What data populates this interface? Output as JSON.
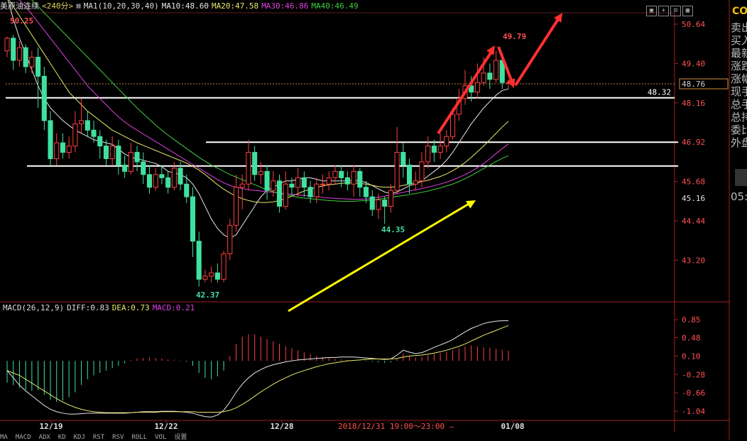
{
  "header": {
    "title": "美原油连续",
    "period": "<240分>",
    "ma_label": "MA1(10,20,30,40)",
    "ma10": "MA10:48.60",
    "ma20": "MA20:47.58",
    "ma30": "MA30:46.86",
    "ma40": "MA40:46.49"
  },
  "colors": {
    "ma10": "#e8e8e8",
    "ma20": "#e8e86a",
    "ma30": "#e040e0",
    "ma40": "#40d040",
    "up": "#ff4040",
    "down": "#40e0a0",
    "hline": "#ffffff",
    "arrow_red": "#ff3030",
    "arrow_yellow": "#ffff00"
  },
  "price_axis": {
    "ticks": [
      "50.64",
      "49.40",
      "48.16",
      "46.92",
      "45.68",
      "44.44",
      "43.20"
    ],
    "current": "48.76",
    "level_label": "48.32",
    "extra": "45.16"
  },
  "price_annotations": {
    "high": "50.25",
    "peak": "49.79",
    "low1": "42.37",
    "low2": "44.35"
  },
  "macd": {
    "label": "MACD(26,12,9)",
    "diff": "DIFF:0.83",
    "dea": "DEA:0.73",
    "macd": "MACD:0.21",
    "ticks": [
      "0.85",
      "0.48",
      "0.10",
      "-0.28",
      "-0.66",
      "-1.04"
    ]
  },
  "time_axis": {
    "labels": [
      "12/19",
      "12/22",
      "12/28",
      "01/08"
    ],
    "cursor": "2018/12/31 19:00～23:00 —"
  },
  "tabs": [
    "MA",
    "MACD",
    "ADX",
    "KD",
    "KDJ",
    "RST",
    "RSV",
    "ROLL",
    "VOL",
    "设置"
  ],
  "side": {
    "code": "CO",
    "lines": [
      "卖出",
      "买入",
      "最新",
      "涨跌",
      "涨幅",
      "现手",
      "总手",
      "总持",
      "委比",
      "外盘"
    ],
    "time": "05:5"
  },
  "chart_data": {
    "type": "candlestick",
    "ylim": [
      42.0,
      51.0
    ],
    "horizontal_levels": [
      48.32,
      46.92,
      46.17
    ],
    "candles": [
      [
        49.8,
        50.2,
        50.25,
        49.6
      ],
      [
        50.2,
        49.5,
        50.3,
        49.2
      ],
      [
        49.5,
        49.9,
        50.1,
        49.3
      ],
      [
        49.9,
        49.3,
        50.0,
        49.1
      ],
      [
        49.3,
        49.6,
        49.8,
        49.1
      ],
      [
        49.6,
        49.0,
        49.9,
        48.0
      ],
      [
        49.0,
        47.6,
        49.3,
        47.3
      ],
      [
        47.6,
        46.4,
        47.9,
        46.2
      ],
      [
        46.4,
        46.9,
        47.2,
        46.2
      ],
      [
        46.9,
        46.6,
        47.2,
        46.4
      ],
      [
        46.6,
        46.8,
        47.1,
        46.4
      ],
      [
        46.8,
        47.5,
        47.9,
        46.6
      ],
      [
        47.5,
        47.6,
        48.3,
        47.2
      ],
      [
        47.6,
        47.3,
        47.9,
        47.1
      ],
      [
        47.3,
        47.1,
        47.6,
        46.9
      ],
      [
        47.1,
        46.8,
        47.3,
        46.4
      ],
      [
        46.8,
        46.4,
        47.0,
        46.2
      ],
      [
        46.4,
        46.8,
        47.1,
        46.2
      ],
      [
        46.8,
        46.2,
        47.0,
        45.9
      ],
      [
        46.2,
        46.0,
        46.5,
        45.8
      ],
      [
        46.0,
        46.6,
        46.9,
        45.9
      ],
      [
        46.6,
        46.3,
        46.8,
        46.0
      ],
      [
        46.3,
        45.9,
        46.6,
        45.6
      ],
      [
        45.9,
        45.5,
        46.2,
        45.3
      ],
      [
        45.5,
        45.9,
        46.1,
        45.4
      ],
      [
        45.9,
        45.8,
        46.2,
        45.6
      ],
      [
        45.8,
        45.5,
        46.0,
        45.3
      ],
      [
        45.5,
        46.1,
        46.3,
        45.4
      ],
      [
        46.1,
        45.6,
        46.3,
        45.4
      ],
      [
        45.6,
        45.2,
        45.9,
        45.0
      ],
      [
        45.2,
        43.8,
        45.5,
        43.3
      ],
      [
        43.8,
        42.6,
        44.1,
        42.37
      ],
      [
        42.6,
        42.7,
        42.9,
        42.5
      ],
      [
        42.7,
        42.8,
        43.0,
        42.5
      ],
      [
        42.8,
        42.6,
        43.1,
        42.5
      ],
      [
        42.6,
        43.4,
        43.5,
        42.5
      ],
      [
        43.4,
        44.3,
        44.5,
        43.2
      ],
      [
        44.3,
        45.5,
        45.9,
        44.1
      ],
      [
        45.5,
        45.6,
        45.9,
        44.8
      ],
      [
        45.6,
        46.6,
        47.0,
        45.4
      ],
      [
        46.6,
        45.9,
        46.8,
        45.7
      ],
      [
        45.9,
        46.0,
        46.3,
        45.6
      ],
      [
        46.0,
        45.4,
        46.2,
        45.1
      ],
      [
        45.4,
        45.7,
        46.0,
        45.2
      ],
      [
        45.7,
        44.9,
        45.9,
        44.7
      ],
      [
        44.9,
        45.6,
        46.0,
        44.8
      ],
      [
        45.6,
        45.5,
        45.8,
        45.2
      ],
      [
        45.5,
        45.8,
        46.1,
        45.2
      ],
      [
        45.8,
        45.5,
        46.0,
        45.2
      ],
      [
        45.5,
        45.2,
        45.7,
        45.0
      ],
      [
        45.2,
        45.6,
        45.8,
        45.0
      ],
      [
        45.6,
        45.6,
        45.9,
        45.3
      ],
      [
        45.6,
        45.8,
        46.0,
        45.4
      ],
      [
        45.8,
        46.0,
        46.2,
        45.6
      ],
      [
        46.0,
        45.8,
        46.2,
        45.5
      ],
      [
        45.8,
        45.6,
        46.0,
        45.4
      ],
      [
        45.6,
        46.0,
        46.2,
        45.2
      ],
      [
        46.0,
        45.5,
        46.1,
        45.2
      ],
      [
        45.5,
        45.2,
        45.7,
        45.0
      ],
      [
        45.2,
        44.8,
        45.4,
        44.6
      ],
      [
        44.8,
        45.1,
        45.3,
        44.5
      ],
      [
        45.1,
        44.9,
        45.2,
        44.35
      ],
      [
        44.9,
        45.4,
        45.6,
        44.7
      ],
      [
        45.4,
        46.6,
        47.4,
        45.3
      ],
      [
        46.6,
        46.2,
        46.9,
        45.8
      ],
      [
        46.2,
        45.6,
        46.4,
        45.3
      ],
      [
        45.6,
        45.7,
        46.0,
        45.4
      ],
      [
        45.7,
        46.3,
        46.6,
        45.5
      ],
      [
        46.3,
        46.8,
        47.1,
        46.1
      ],
      [
        46.8,
        46.6,
        47.0,
        46.3
      ],
      [
        46.6,
        46.8,
        47.2,
        46.4
      ],
      [
        46.8,
        47.1,
        47.3,
        46.6
      ],
      [
        47.1,
        47.8,
        48.0,
        47.0
      ],
      [
        47.8,
        48.3,
        48.6,
        47.6
      ],
      [
        48.3,
        48.7,
        49.2,
        48.1
      ],
      [
        48.7,
        48.5,
        49.0,
        48.2
      ],
      [
        48.5,
        48.8,
        49.4,
        48.3
      ],
      [
        48.8,
        49.1,
        49.6,
        48.7
      ],
      [
        49.1,
        48.9,
        49.4,
        48.6
      ],
      [
        48.9,
        49.5,
        49.79,
        48.8
      ],
      [
        49.5,
        48.8,
        49.7,
        48.6
      ],
      [
        48.8,
        48.8,
        48.9,
        48.6
      ]
    ],
    "ma_series": [
      {
        "name": "MA10",
        "color": "#e8e8e8",
        "values": [
          51.5,
          50.8,
          50.2,
          49.7,
          49.2,
          48.7,
          48.3,
          48.0,
          47.8,
          47.6,
          47.45,
          47.3,
          47.2,
          47.1,
          47.0,
          46.95,
          46.9,
          46.85,
          46.7,
          46.55,
          46.45,
          46.4,
          46.35,
          46.3,
          46.25,
          46.15,
          46.0,
          45.95,
          45.9,
          45.8,
          45.6,
          45.3,
          44.9,
          44.5,
          44.2,
          44.0,
          43.9,
          44.0,
          44.3,
          44.6,
          44.9,
          45.2,
          45.4,
          45.5,
          45.6,
          45.7,
          45.7,
          45.75,
          45.8,
          45.8,
          45.75,
          45.7,
          45.7,
          45.7,
          45.7,
          45.7,
          45.72,
          45.7,
          45.65,
          45.55,
          45.45,
          45.35,
          45.3,
          45.35,
          45.45,
          45.55,
          45.6,
          45.7,
          45.85,
          46.0,
          46.15,
          46.35,
          46.6,
          46.9,
          47.2,
          47.5,
          47.75,
          48.0,
          48.2,
          48.4,
          48.55,
          48.6
        ]
      },
      {
        "name": "MA20",
        "color": "#e8e86a",
        "values": [
          51.5,
          51.2,
          50.9,
          50.6,
          50.3,
          50.0,
          49.7,
          49.4,
          49.1,
          48.8,
          48.5,
          48.3,
          48.1,
          47.9,
          47.75,
          47.6,
          47.45,
          47.3,
          47.2,
          47.1,
          47.0,
          46.9,
          46.82,
          46.74,
          46.66,
          46.58,
          46.5,
          46.42,
          46.34,
          46.26,
          46.16,
          46.04,
          45.9,
          45.74,
          45.58,
          45.44,
          45.32,
          45.22,
          45.14,
          45.08,
          45.04,
          45.02,
          45.02,
          45.04,
          45.08,
          45.14,
          45.22,
          45.3,
          45.38,
          45.44,
          45.5,
          45.54,
          45.58,
          45.6,
          45.62,
          45.64,
          45.64,
          45.62,
          45.6,
          45.56,
          45.52,
          45.5,
          45.5,
          45.52,
          45.56,
          45.6,
          45.64,
          45.68,
          45.72,
          45.78,
          45.84,
          45.92,
          46.02,
          46.14,
          46.28,
          46.44,
          46.62,
          46.8,
          47.0,
          47.2,
          47.4,
          47.58
        ]
      },
      {
        "name": "MA30",
        "color": "#e040e0",
        "values": [
          51.8,
          51.6,
          51.4,
          51.2,
          50.95,
          50.7,
          50.45,
          50.2,
          49.95,
          49.7,
          49.45,
          49.2,
          48.95,
          48.7,
          48.5,
          48.3,
          48.1,
          47.9,
          47.72,
          47.56,
          47.42,
          47.3,
          47.18,
          47.06,
          46.94,
          46.82,
          46.7,
          46.58,
          46.46,
          46.34,
          46.22,
          46.1,
          45.98,
          45.86,
          45.74,
          45.64,
          45.56,
          45.5,
          45.46,
          45.42,
          45.4,
          45.38,
          45.36,
          45.34,
          45.32,
          45.3,
          45.28,
          45.26,
          45.24,
          45.22,
          45.2,
          45.18,
          45.16,
          45.15,
          45.14,
          45.13,
          45.12,
          45.12,
          45.13,
          45.15,
          45.18,
          45.22,
          45.26,
          45.3,
          45.34,
          45.38,
          45.42,
          45.46,
          45.5,
          45.55,
          45.6,
          45.66,
          45.73,
          45.81,
          45.9,
          46.0,
          46.12,
          46.25,
          46.4,
          46.56,
          46.72,
          46.86
        ]
      },
      {
        "name": "MA40",
        "color": "#40d040",
        "values": [
          52.2,
          52.0,
          51.8,
          51.6,
          51.4,
          51.2,
          51.0,
          50.8,
          50.6,
          50.4,
          50.2,
          50.0,
          49.8,
          49.6,
          49.4,
          49.2,
          49.0,
          48.8,
          48.6,
          48.4,
          48.2,
          48.0,
          47.82,
          47.64,
          47.46,
          47.3,
          47.14,
          47.0,
          46.86,
          46.72,
          46.58,
          46.44,
          46.32,
          46.2,
          46.1,
          46.0,
          45.9,
          45.82,
          45.74,
          45.66,
          45.58,
          45.5,
          45.42,
          45.36,
          45.3,
          45.26,
          45.22,
          45.18,
          45.16,
          45.14,
          45.12,
          45.1,
          45.08,
          45.07,
          45.06,
          45.06,
          45.06,
          45.07,
          45.08,
          45.1,
          45.12,
          45.15,
          45.18,
          45.21,
          45.24,
          45.27,
          45.3,
          45.34,
          45.38,
          45.43,
          45.48,
          45.54,
          45.6,
          45.68,
          45.77,
          45.87,
          45.98,
          46.09,
          46.2,
          46.31,
          46.41,
          46.49
        ]
      }
    ],
    "macd_ylim": [
      -1.2,
      1.0
    ],
    "macd_hist": [
      -0.45,
      -0.5,
      -0.55,
      -0.6,
      -0.62,
      -0.6,
      -0.7,
      -0.8,
      -0.85,
      -0.82,
      -0.75,
      -0.65,
      -0.5,
      -0.38,
      -0.3,
      -0.25,
      -0.2,
      -0.15,
      -0.1,
      -0.05,
      0.02,
      0.05,
      0.06,
      0.07,
      0.06,
      0.05,
      0.03,
      0.02,
      0.01,
      -0.02,
      -0.1,
      -0.25,
      -0.35,
      -0.38,
      -0.32,
      -0.2,
      0.1,
      0.35,
      0.5,
      0.55,
      0.55,
      0.5,
      0.45,
      0.4,
      0.35,
      0.3,
      0.26,
      0.22,
      0.18,
      0.14,
      0.1,
      0.08,
      0.06,
      0.04,
      0.03,
      0.02,
      0.01,
      0.0,
      -0.01,
      -0.02,
      -0.03,
      -0.04,
      -0.03,
      0.05,
      0.15,
      0.1,
      0.07,
      0.08,
      0.12,
      0.14,
      0.16,
      0.19,
      0.22,
      0.26,
      0.3,
      0.32,
      0.3,
      0.28,
      0.27,
      0.25,
      0.23,
      0.21
    ],
    "macd_diff": [
      -0.2,
      -0.35,
      -0.5,
      -0.62,
      -0.72,
      -0.82,
      -0.92,
      -1.0,
      -1.05,
      -1.08,
      -1.1,
      -1.1,
      -1.09,
      -1.08,
      -1.08,
      -1.08,
      -1.08,
      -1.08,
      -1.08,
      -1.08,
      -1.07,
      -1.06,
      -1.05,
      -1.05,
      -1.05,
      -1.04,
      -1.04,
      -1.04,
      -1.05,
      -1.06,
      -1.08,
      -1.12,
      -1.15,
      -1.16,
      -1.12,
      -1.02,
      -0.85,
      -0.65,
      -0.48,
      -0.35,
      -0.25,
      -0.18,
      -0.12,
      -0.08,
      -0.05,
      -0.02,
      0.0,
      0.02,
      0.03,
      0.04,
      0.05,
      0.06,
      0.07,
      0.07,
      0.08,
      0.08,
      0.08,
      0.07,
      0.06,
      0.05,
      0.04,
      0.03,
      0.04,
      0.12,
      0.22,
      0.18,
      0.15,
      0.17,
      0.22,
      0.28,
      0.33,
      0.38,
      0.44,
      0.52,
      0.6,
      0.67,
      0.72,
      0.77,
      0.8,
      0.82,
      0.83,
      0.83
    ],
    "macd_dea": [
      -0.2,
      -0.25,
      -0.3,
      -0.38,
      -0.46,
      -0.54,
      -0.62,
      -0.7,
      -0.78,
      -0.85,
      -0.91,
      -0.96,
      -1.0,
      -1.03,
      -1.05,
      -1.06,
      -1.07,
      -1.07,
      -1.07,
      -1.07,
      -1.07,
      -1.06,
      -1.06,
      -1.06,
      -1.06,
      -1.05,
      -1.05,
      -1.05,
      -1.05,
      -1.05,
      -1.05,
      -1.06,
      -1.06,
      -1.06,
      -1.06,
      -1.05,
      -1.02,
      -0.97,
      -0.9,
      -0.82,
      -0.73,
      -0.64,
      -0.56,
      -0.48,
      -0.41,
      -0.35,
      -0.29,
      -0.24,
      -0.2,
      -0.16,
      -0.12,
      -0.09,
      -0.06,
      -0.04,
      -0.02,
      0.0,
      0.01,
      0.02,
      0.03,
      0.04,
      0.04,
      0.04,
      0.04,
      0.05,
      0.08,
      0.1,
      0.11,
      0.12,
      0.14,
      0.16,
      0.19,
      0.22,
      0.26,
      0.3,
      0.35,
      0.41,
      0.47,
      0.53,
      0.58,
      0.63,
      0.68,
      0.73
    ]
  }
}
